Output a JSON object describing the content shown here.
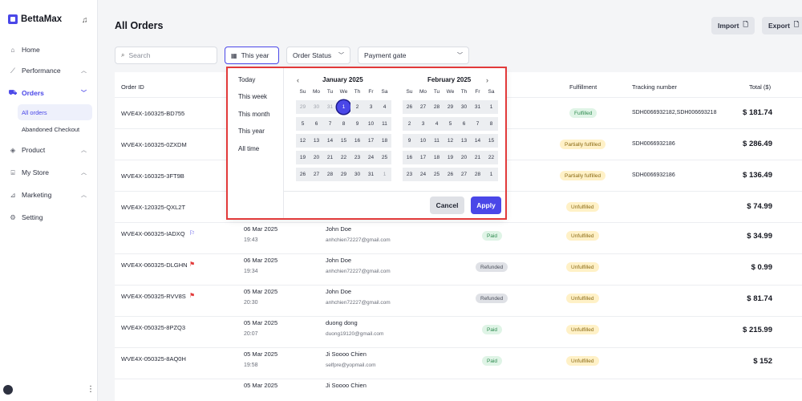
{
  "app": {
    "name": "BettaMax",
    "logo_icon": "brand-logo-icon"
  },
  "sidebar": {
    "items": [
      {
        "label": "Home",
        "icon": "home-icon",
        "has_chevron": false
      },
      {
        "label": "Performance",
        "icon": "chart-icon",
        "has_chevron": true
      },
      {
        "label": "Orders",
        "icon": "cart-icon",
        "has_chevron": true,
        "active": true
      },
      {
        "label": "Product",
        "icon": "box-icon",
        "has_chevron": true
      },
      {
        "label": "My Store",
        "icon": "store-icon",
        "has_chevron": true
      },
      {
        "label": "Marketing",
        "icon": "megaphone-icon",
        "has_chevron": true
      },
      {
        "label": "Setting",
        "icon": "gear-icon",
        "has_chevron": false
      }
    ],
    "sub_items": [
      {
        "label": "All orders",
        "active": true
      },
      {
        "label": "Abandoned Checkout",
        "active": false
      }
    ]
  },
  "header": {
    "title": "All Orders",
    "import_label": "Import",
    "export_label": "Export"
  },
  "filters": {
    "search_placeholder": "Search",
    "date_label": "This year",
    "status_label": "Order Status",
    "payment_label": "Payment gate"
  },
  "table": {
    "columns": {
      "order_id": "Order ID",
      "fulfillment": "Fulfillment",
      "tracking": "Tracking number",
      "total": "Total ($)"
    },
    "rows": [
      {
        "id": "WVE4X-160325-BD755",
        "date": "",
        "time": "",
        "customer": "",
        "email": "",
        "payment": "",
        "fulfillment": "Fulfilled",
        "tracking": "SDH0066932182,SDH006693218",
        "total": "$ 181.74"
      },
      {
        "id": "WVE4X-160325-0ZXDM",
        "date": "",
        "time": "",
        "customer": "",
        "email": "",
        "payment": "",
        "fulfillment": "Partially fulfilled",
        "tracking": "SDH0066932186",
        "total": "$ 286.49"
      },
      {
        "id": "WVE4X-160325-3FT9B",
        "date": "",
        "time": "",
        "customer": "",
        "email": "",
        "payment": "",
        "fulfillment": "Partially fulfilled",
        "tracking": "SDH0066932186",
        "total": "$ 136.49"
      },
      {
        "id": "WVE4X-120325-QXL2T",
        "date": "",
        "time": "",
        "customer": "",
        "email": "",
        "payment": "",
        "fulfillment": "Unfulfilled",
        "tracking": "",
        "total": "$ 74.99"
      },
      {
        "id": "WVE4X-060325-IADXQ",
        "icon": "flag-blue-icon",
        "date": "06 Mar 2025",
        "time": "19:43",
        "customer": "John Doe",
        "email": "anhchien72227@gmail.com",
        "payment": "Paid",
        "fulfillment": "Unfulfilled",
        "tracking": "",
        "total": "$ 34.99"
      },
      {
        "id": "WVE4X-060325-DLGHN",
        "icon": "flag-red-icon",
        "date": "06 Mar 2025",
        "time": "19:34",
        "customer": "John Doe",
        "email": "anhchien72227@gmail.com",
        "payment": "Refunded",
        "fulfillment": "Unfulfilled",
        "tracking": "",
        "total": "$ 0.99"
      },
      {
        "id": "WVE4X-050325-RVV8S",
        "icon": "flag-red-icon",
        "date": "05 Mar 2025",
        "time": "20:30",
        "customer": "John Doe",
        "email": "anhchien72227@gmail.com",
        "payment": "Refunded",
        "fulfillment": "Unfulfilled",
        "tracking": "",
        "total": "$ 81.74"
      },
      {
        "id": "WVE4X-050325-8PZQ3",
        "date": "05 Mar 2025",
        "time": "20:07",
        "customer": "duong dong",
        "email": "duong19120@gmail.com",
        "payment": "Paid",
        "fulfillment": "Unfulfilled",
        "tracking": "",
        "total": "$ 215.99"
      },
      {
        "id": "WVE4X-050325-8AQ0H",
        "date": "05 Mar 2025",
        "time": "19:58",
        "customer": "Ji Soooo Chien",
        "email": "selfpre@yopmail.com",
        "payment": "Paid",
        "fulfillment": "Unfulfilled",
        "tracking": "",
        "total": "$ 152"
      },
      {
        "id": "",
        "date": "05 Mar 2025",
        "time": "",
        "customer": "Ji Soooo Chien",
        "email": "",
        "payment": "",
        "fulfillment": "",
        "tracking": "",
        "total": ""
      }
    ]
  },
  "date_picker": {
    "presets": [
      "Today",
      "This week",
      "This month",
      "This year",
      "All time"
    ],
    "weekdays": [
      "Su",
      "Mo",
      "Tu",
      "We",
      "Th",
      "Fr",
      "Sa"
    ],
    "months": [
      {
        "title": "January 2025",
        "days": [
          "29",
          "30",
          "31",
          "1",
          "2",
          "3",
          "4",
          "5",
          "6",
          "7",
          "8",
          "9",
          "10",
          "11",
          "12",
          "13",
          "14",
          "15",
          "16",
          "17",
          "18",
          "19",
          "20",
          "21",
          "22",
          "23",
          "24",
          "25",
          "26",
          "27",
          "28",
          "29",
          "30",
          "31",
          "1"
        ],
        "outside": [
          0,
          1,
          2,
          34
        ],
        "selected": 3
      },
      {
        "title": "February 2025",
        "days": [
          "26",
          "27",
          "28",
          "29",
          "30",
          "31",
          "1",
          "2",
          "3",
          "4",
          "5",
          "6",
          "7",
          "8",
          "9",
          "10",
          "11",
          "12",
          "13",
          "14",
          "15",
          "16",
          "17",
          "18",
          "19",
          "20",
          "21",
          "22",
          "23",
          "24",
          "25",
          "26",
          "27",
          "28",
          "1"
        ],
        "outside": [],
        "selected": -1
      }
    ],
    "cancel_label": "Cancel",
    "apply_label": "Apply"
  },
  "colors": {
    "accent": "#4a47e8",
    "highlight": "#e23a3a"
  }
}
